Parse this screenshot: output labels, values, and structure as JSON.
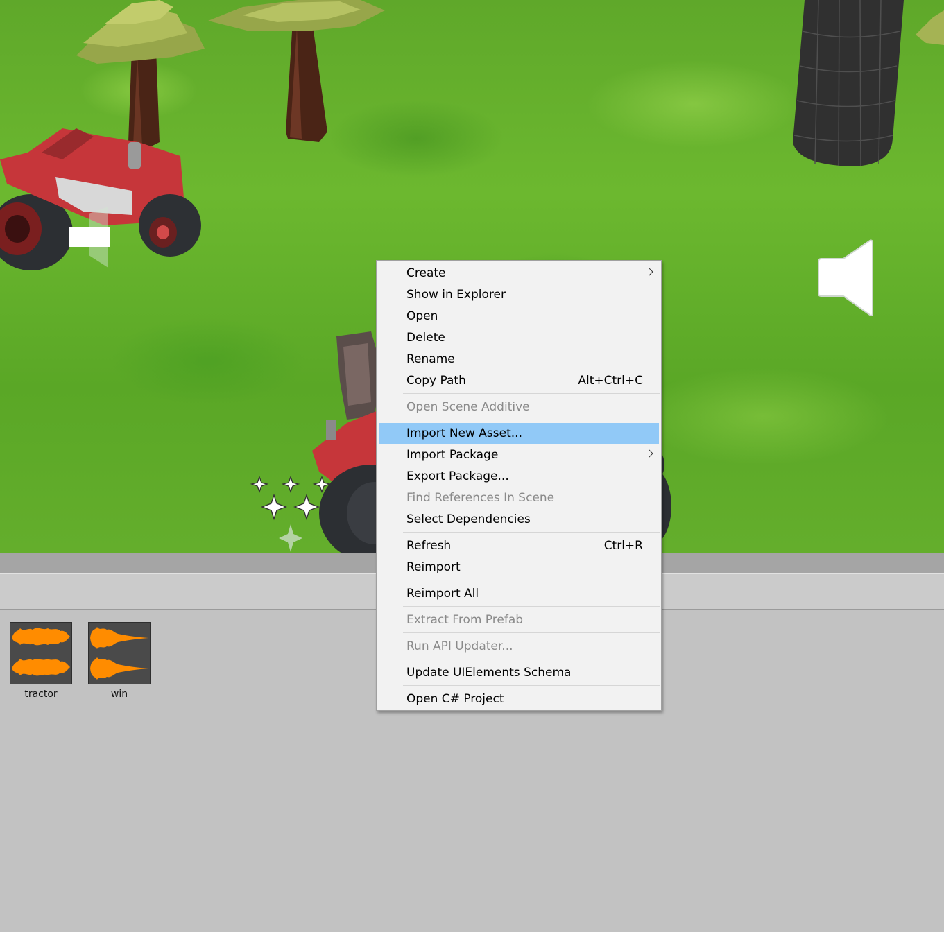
{
  "menu": {
    "items": [
      {
        "label": "Create",
        "shortcut": "",
        "submenu": true,
        "disabled": false
      },
      {
        "label": "Show in Explorer",
        "shortcut": "",
        "submenu": false,
        "disabled": false
      },
      {
        "label": "Open",
        "shortcut": "",
        "submenu": false,
        "disabled": false
      },
      {
        "label": "Delete",
        "shortcut": "",
        "submenu": false,
        "disabled": false
      },
      {
        "label": "Rename",
        "shortcut": "",
        "submenu": false,
        "disabled": false
      },
      {
        "label": "Copy Path",
        "shortcut": "Alt+Ctrl+C",
        "submenu": false,
        "disabled": false
      },
      {
        "label": "Open Scene Additive",
        "shortcut": "",
        "submenu": false,
        "disabled": true
      },
      {
        "label": "Import New Asset...",
        "shortcut": "",
        "submenu": false,
        "disabled": false,
        "highlighted": true
      },
      {
        "label": "Import Package",
        "shortcut": "",
        "submenu": true,
        "disabled": false
      },
      {
        "label": "Export Package...",
        "shortcut": "",
        "submenu": false,
        "disabled": false
      },
      {
        "label": "Find References In Scene",
        "shortcut": "",
        "submenu": false,
        "disabled": true
      },
      {
        "label": "Select Dependencies",
        "shortcut": "",
        "submenu": false,
        "disabled": false
      },
      {
        "label": "Refresh",
        "shortcut": "Ctrl+R",
        "submenu": false,
        "disabled": false
      },
      {
        "label": "Reimport",
        "shortcut": "",
        "submenu": false,
        "disabled": false
      },
      {
        "label": "Reimport All",
        "shortcut": "",
        "submenu": false,
        "disabled": false
      },
      {
        "label": "Extract From Prefab",
        "shortcut": "",
        "submenu": false,
        "disabled": true
      },
      {
        "label": "Run API Updater...",
        "shortcut": "",
        "submenu": false,
        "disabled": true
      },
      {
        "label": "Update UIElements Schema",
        "shortcut": "",
        "submenu": false,
        "disabled": false
      },
      {
        "label": "Open C# Project",
        "shortcut": "",
        "submenu": false,
        "disabled": false
      }
    ]
  },
  "assets": [
    {
      "name": "tractor",
      "type": "audio-clip-icon"
    },
    {
      "name": "win",
      "type": "audio-clip-icon"
    }
  ],
  "colors": {
    "highlight": "#91c9f7",
    "waveform": "#ff8c00",
    "grass": "#5fa82a"
  }
}
